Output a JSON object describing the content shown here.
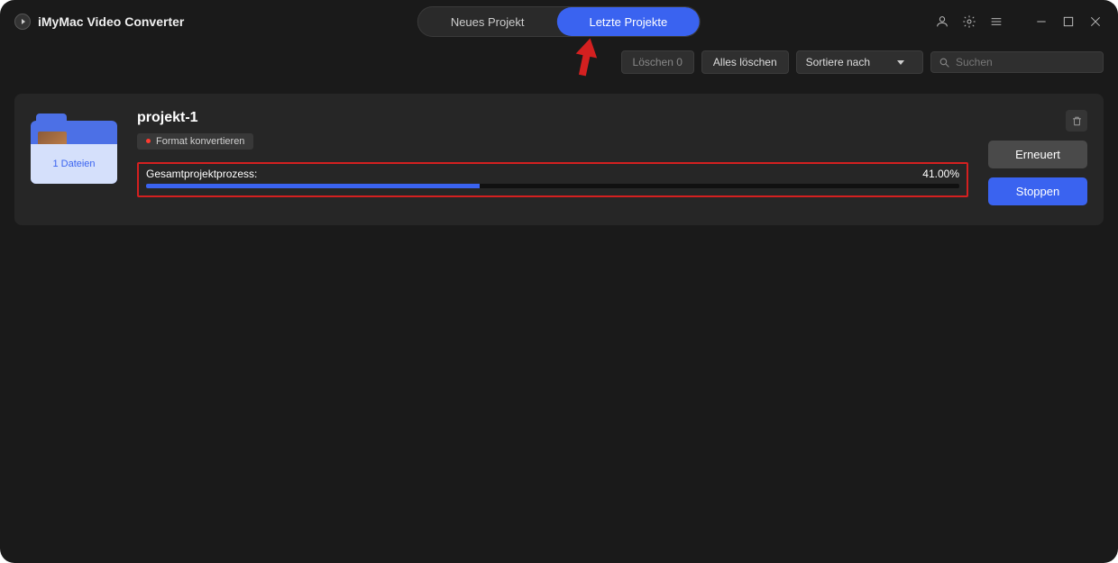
{
  "app": {
    "title": "iMyMac Video Converter"
  },
  "tabs": {
    "new_project": "Neues Projekt",
    "recent_projects": "Letzte Projekte"
  },
  "toolbar": {
    "delete_count": "Löschen 0",
    "delete_all": "Alles löschen",
    "sort_by": "Sortiere nach",
    "search_placeholder": "Suchen"
  },
  "project": {
    "name": "projekt-1",
    "file_count": "1 Dateien",
    "badge": "Format konvertieren",
    "progress_label": "Gesamtprojektprozess:",
    "progress_text": "41.00%",
    "progress_value": 41.0,
    "button_renew": "Erneuert",
    "button_stop": "Stoppen"
  }
}
